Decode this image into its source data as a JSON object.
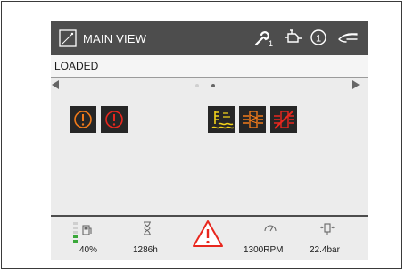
{
  "header": {
    "title": "MAIN VIEW",
    "service_count": "1",
    "info_suffix": ".."
  },
  "status": {
    "text": "LOADED"
  },
  "pager": {
    "page_count": 2,
    "active_page": 2
  },
  "warnings": [
    {
      "icon": "engine-warning-icon",
      "color": "#f07a1a"
    },
    {
      "icon": "engine-stop-icon",
      "color": "#e8271e"
    },
    {
      "icon": "coolant-level-icon",
      "color": "#f2d21b"
    },
    {
      "icon": "air-filter-icon",
      "color": "#f07a1a"
    },
    {
      "icon": "air-filter-crossed-icon",
      "color": "#e8271e"
    }
  ],
  "footer": {
    "fuel_label": "40%",
    "fuel_level_percent": 40,
    "hours_label": "1286h",
    "rpm_label": "1300RPM",
    "pressure_label": "22.4bar"
  },
  "colors": {
    "header_bg": "#4d4d4d",
    "screen_bg": "#ececec",
    "fuel_green": "#3aa83a",
    "alert_red": "#e8271e"
  }
}
